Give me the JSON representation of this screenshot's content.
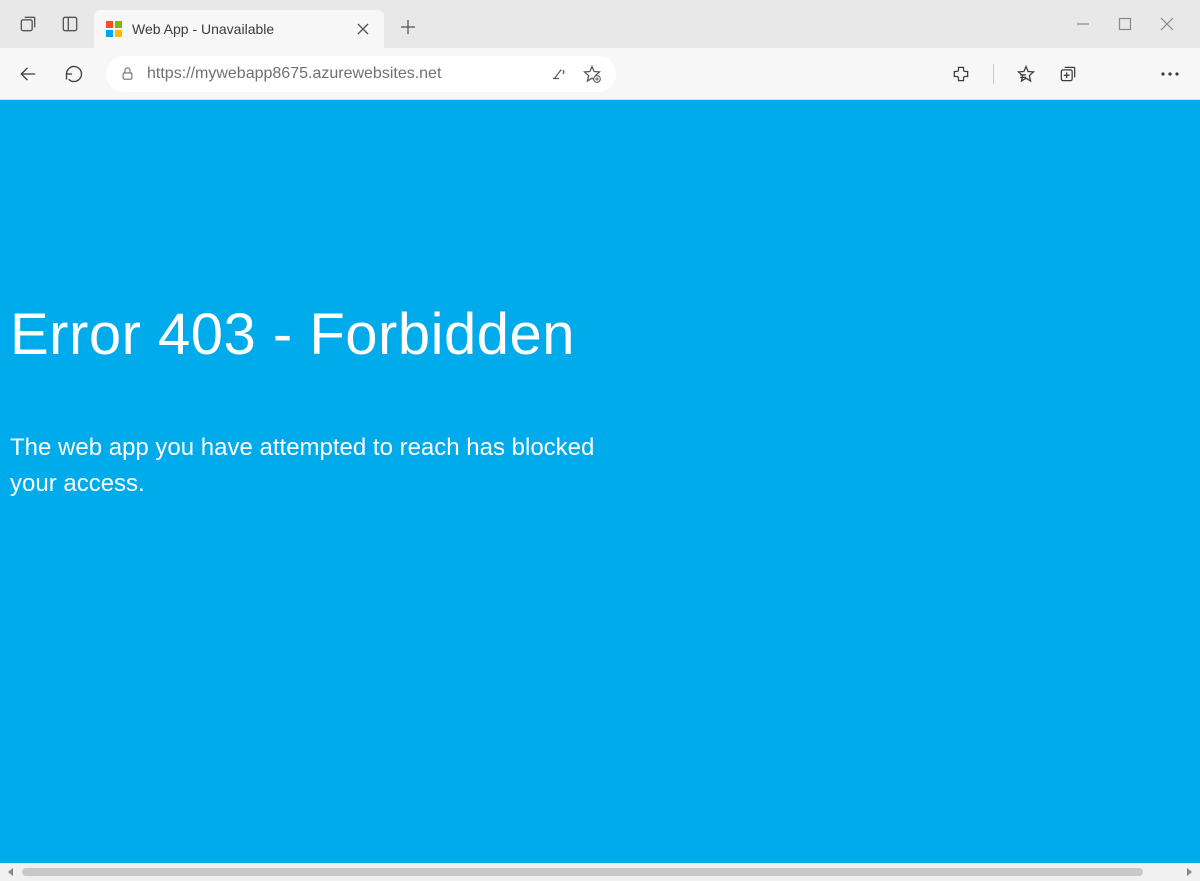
{
  "tab": {
    "title": "Web App - Unavailable"
  },
  "url": "https://mywebapp8675.azurewebsites.net",
  "page": {
    "title": "Error 403 - Forbidden",
    "message": "The web app you have attempted to reach has blocked your access."
  }
}
